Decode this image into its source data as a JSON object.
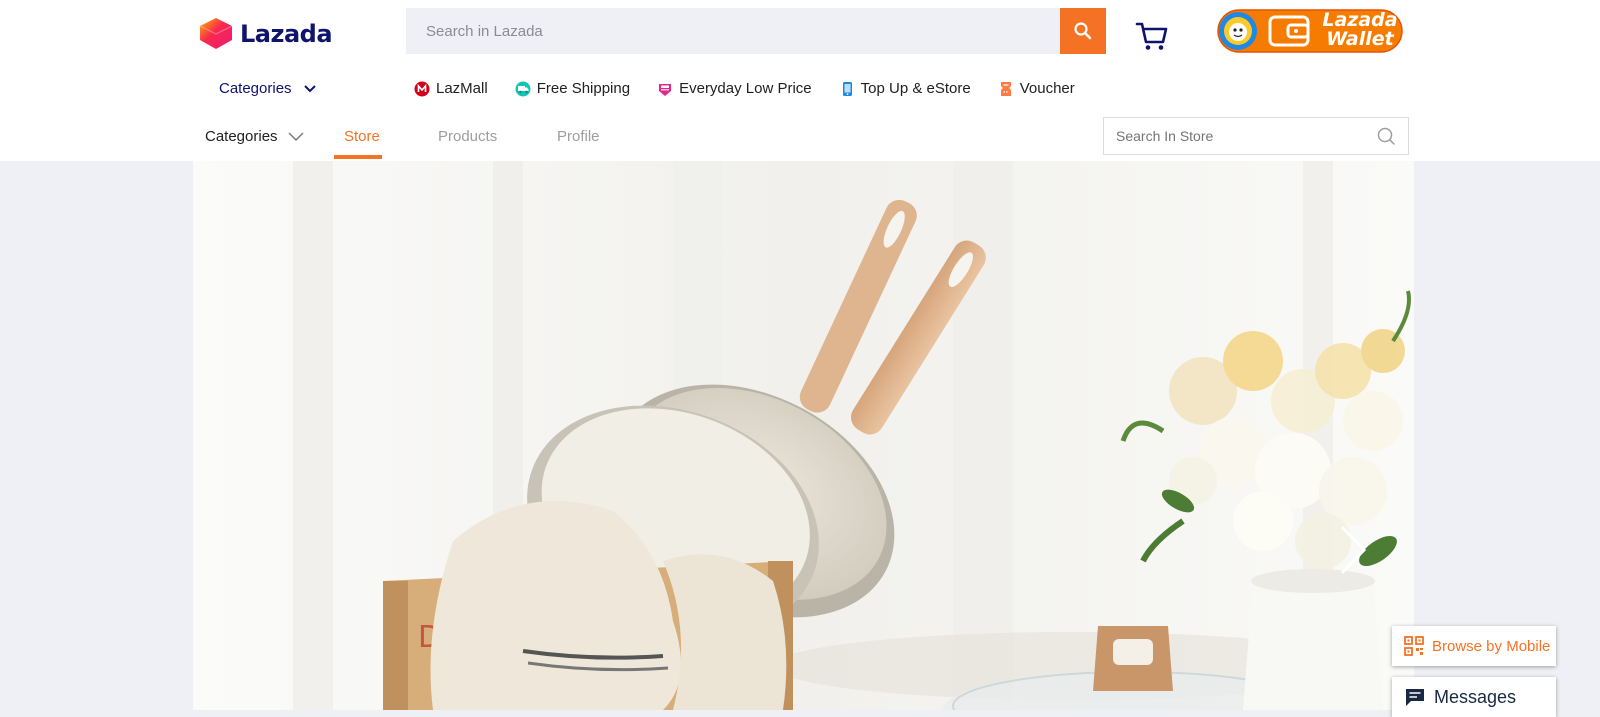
{
  "header": {
    "logo_text": "Lazada",
    "search_placeholder": "Search in Lazada",
    "search_icon": "search-icon",
    "cart_icon": "cart-icon",
    "wallet": {
      "line1": "Lazada",
      "line2": "Wallet"
    }
  },
  "nav": {
    "categories_label": "Categories",
    "links": [
      {
        "label": "LazMall",
        "icon": "lazmall-icon"
      },
      {
        "label": "Free Shipping",
        "icon": "free-shipping-icon"
      },
      {
        "label": "Everyday Low Price",
        "icon": "low-price-icon"
      },
      {
        "label": "Top Up & eStore",
        "icon": "top-up-icon"
      },
      {
        "label": "Voucher",
        "icon": "voucher-icon"
      }
    ]
  },
  "store": {
    "categories_label": "Categories",
    "tabs": [
      {
        "label": "Store",
        "active": true
      },
      {
        "label": "Products",
        "active": false
      },
      {
        "label": "Profile",
        "active": false
      }
    ],
    "search_placeholder": "Search In Store"
  },
  "banner": {
    "crate_text": "DR"
  },
  "floating": {
    "browse_mobile": "Browse by Mobile",
    "messages": "Messages"
  },
  "colors": {
    "brand_orange": "#f57224",
    "brand_navy": "#0f146d",
    "page_bg": "#eff0f5"
  }
}
